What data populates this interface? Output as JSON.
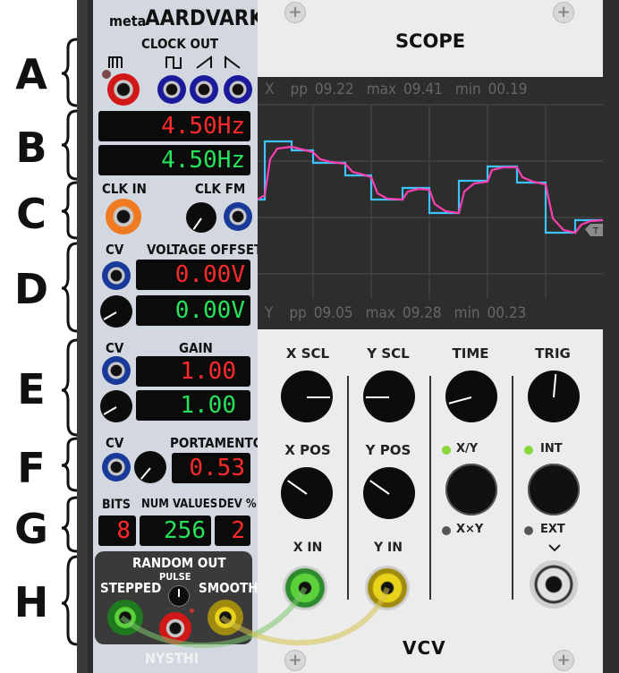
{
  "letters": [
    "A",
    "B",
    "C",
    "D",
    "E",
    "F",
    "G",
    "H"
  ],
  "nysthi": {
    "brand_prefix": "meta",
    "brand_name": "AARDVARK",
    "clock_out_label": "CLOCK OUT",
    "freq_red": "4.50Hz",
    "freq_green": "4.50Hz",
    "clk_in_label": "CLK IN",
    "clk_fm_label": "CLK FM",
    "cv_label": "CV",
    "voltage_offset_label": "VOLTAGE OFFSET",
    "offset_red": "0.00V",
    "offset_green": "0.00V",
    "gain_label": "GAIN",
    "gain_red": "1.00",
    "gain_green": "1.00",
    "portamento_label": "PORTAMENTO",
    "portamento_value": "0.53",
    "bits_label": "BITS",
    "num_values_label": "NUM VALUES",
    "dev_label": "DEV %",
    "bits_value": "8",
    "num_values_value": "256",
    "dev_value": "2",
    "random_out_label": "RANDOM OUT",
    "pulse_label": "PULSE",
    "stepped_label": "STEPPED",
    "smooth_label": "SMOOTH",
    "footer": "NYSTHI"
  },
  "scope": {
    "title": "SCOPE",
    "x_readout": {
      "axis": "X",
      "pp_label": "pp",
      "pp": "09.22",
      "max_label": "max",
      "max": "09.41",
      "min_label": "min",
      "min": "00.19"
    },
    "y_readout": {
      "axis": "Y",
      "pp_label": "pp",
      "pp": "09.05",
      "max_label": "max",
      "max": "09.28",
      "min_label": "min",
      "min": "00.23"
    },
    "trigger_marker": "T",
    "x_scl_label": "X SCL",
    "y_scl_label": "Y SCL",
    "time_label": "TIME",
    "trig_label": "TRIG",
    "x_pos_label": "X POS",
    "y_pos_label": "Y POS",
    "xy_label": "X/Y",
    "xxy_label": "X×Y",
    "int_label": "INT",
    "ext_label": "EXT",
    "x_in_label": "X IN",
    "y_in_label": "Y IN",
    "logo": "VCV",
    "colors": {
      "trace_x": "#3fc3ff",
      "trace_y": "#ff3fb0",
      "led_on": "#8bd63a",
      "led_off": "#555555"
    }
  }
}
